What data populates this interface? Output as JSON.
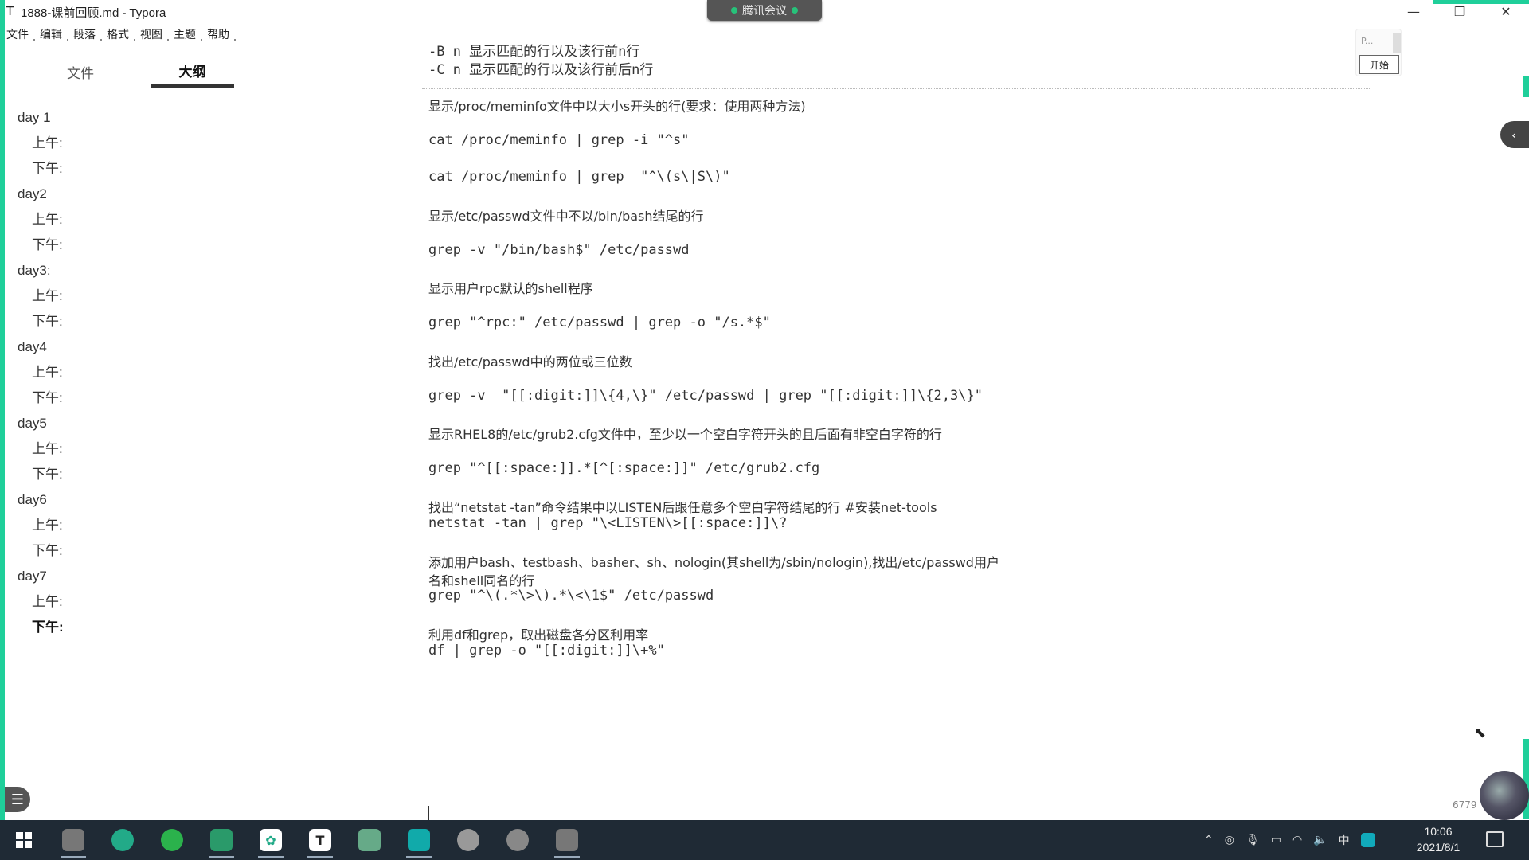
{
  "window": {
    "app_icon": "T",
    "title": "1888-课前回顾.md - Typora",
    "meeting_label": "腾讯会议",
    "minimize": "—",
    "maximize": "❐",
    "close": "✕"
  },
  "menu": [
    "文件",
    "编辑",
    "段落",
    "格式",
    "视图",
    "主题",
    "帮助"
  ],
  "sidebar": {
    "tab_files": "文件",
    "tab_outline": "大纲",
    "outline": [
      {
        "label": "day 1",
        "level": 1
      },
      {
        "label": "上午:",
        "level": 2
      },
      {
        "label": "下午:",
        "level": 2
      },
      {
        "label": "day2",
        "level": 1
      },
      {
        "label": "上午:",
        "level": 2
      },
      {
        "label": "下午:",
        "level": 2
      },
      {
        "label": "day3:",
        "level": 1
      },
      {
        "label": "上午:",
        "level": 2
      },
      {
        "label": "下午:",
        "level": 2
      },
      {
        "label": "day4",
        "level": 1
      },
      {
        "label": "上午:",
        "level": 2
      },
      {
        "label": "下午:",
        "level": 2
      },
      {
        "label": "day5",
        "level": 1
      },
      {
        "label": "上午:",
        "level": 2
      },
      {
        "label": "下午:",
        "level": 2
      },
      {
        "label": "day6",
        "level": 1
      },
      {
        "label": "上午:",
        "level": 2
      },
      {
        "label": "下午:",
        "level": 2
      },
      {
        "label": "day7",
        "level": 1
      },
      {
        "label": "上午:",
        "level": 2
      },
      {
        "label": "下午:",
        "level": 2,
        "active": true
      }
    ],
    "toggle_icon": "☰",
    "back_icon": "‹",
    "source_icon": "</>"
  },
  "editor": {
    "lines": [
      "-B n 显示匹配的行以及该行前n行",
      "-C n 显示匹配的行以及该行前后n行",
      "显示/proc/meminfo文件中以大小s开头的行(要求：使用两种方法)",
      "cat /proc/meminfo | grep -i \"^s\"",
      "cat /proc/meminfo | grep  \"^\\(s\\|S\\)\"",
      "显示/etc/passwd文件中不以/bin/bash结尾的行",
      "grep -v \"/bin/bash$\" /etc/passwd",
      "显示用户rpc默认的shell程序",
      "grep \"^rpc:\" /etc/passwd | grep -o \"/s.*$\"",
      "找出/etc/passwd中的两位或三位数",
      "grep -v  \"[[:digit:]]\\{4,\\}\" /etc/passwd | grep \"[[:digit:]]\\{2,3\\}\"",
      "显示RHEL8的/etc/grub2.cfg文件中，至少以一个空白字符开头的且后面有非空白字符的行",
      "grep \"^[[:space:]].*[^[:space:]]\" /etc/grub2.cfg",
      "找出“netstat -tan”命令结果中以LISTEN后跟任意多个空白字符结尾的行 #安装net-tools",
      "netstat -tan | grep \"\\<LISTEN\\>[[:space:]]\\?",
      "添加用户bash、testbash、basher、sh、nologin(其shell为/sbin/nologin),找出/etc/passwd用户",
      "名和shell同名的行",
      "grep \"^\\(.*\\>\\).*\\<\\1$\" /etc/passwd",
      "利用df和grep，取出磁盘各分区利用率",
      "df | grep -o \"[[:digit:]]\\+%\""
    ]
  },
  "widget": {
    "placeholder": "P...",
    "start_button": "开始"
  },
  "right_collapse_icon": "‹",
  "word_count": "6779",
  "taskbar": {
    "tray_lang": "中",
    "time": "10:06",
    "date": "2021/8/1"
  }
}
